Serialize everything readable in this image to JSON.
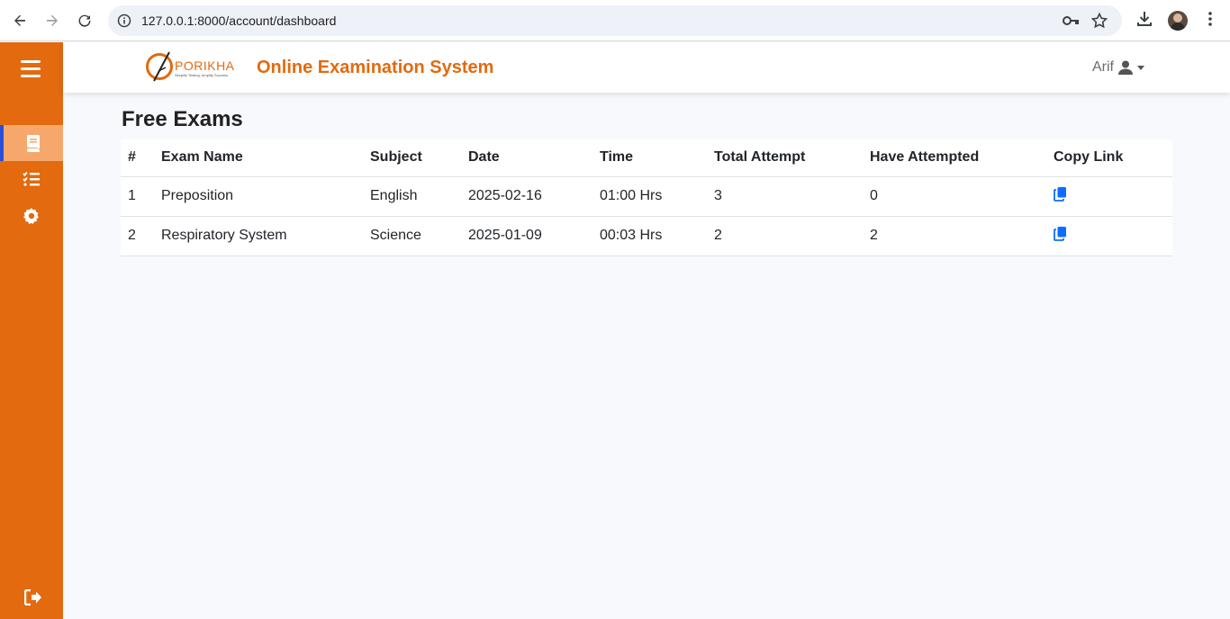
{
  "browser": {
    "url": "127.0.0.1:8000/account/dashboard"
  },
  "sidebar": {
    "items": [
      {
        "icon": "book-icon",
        "active": true
      },
      {
        "icon": "task-list-icon",
        "active": false
      },
      {
        "icon": "gear-icon",
        "active": false
      }
    ],
    "logout_icon": "logout-icon"
  },
  "header": {
    "logo_text": "PORIKHA",
    "logo_tagline": "Simplify Testing, Amplify Success",
    "title": "Online Examination System",
    "user_name": "Arif"
  },
  "main": {
    "title": "Free Exams",
    "columns": [
      "#",
      "Exam Name",
      "Subject",
      "Date",
      "Time",
      "Total Attempt",
      "Have Attempted",
      "Copy Link"
    ],
    "rows": [
      {
        "num": "1",
        "exam_name": "Preposition",
        "subject": "English",
        "date": "2025-02-16",
        "time": "01:00 Hrs",
        "total_attempt": "3",
        "have_attempted": "0"
      },
      {
        "num": "2",
        "exam_name": "Respiratory System",
        "subject": "Science",
        "date": "2025-01-09",
        "time": "00:03 Hrs",
        "total_attempt": "2",
        "have_attempted": "2"
      }
    ]
  },
  "colors": {
    "brand": "#e36a0e",
    "sidebar_active": "#f6a86c",
    "link_icon": "#0d6efd"
  }
}
